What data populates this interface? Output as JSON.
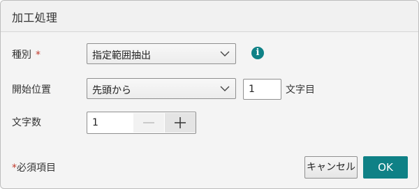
{
  "dialog": {
    "title": "加工処理"
  },
  "fields": {
    "type": {
      "label": "種別",
      "required_mark": "*",
      "value": "指定範囲抽出"
    },
    "start_position": {
      "label": "開始位置",
      "value": "先頭から",
      "offset": "1",
      "suffix": "文字目"
    },
    "char_count": {
      "label": "文字数",
      "value": "1"
    }
  },
  "footer": {
    "required_star": "*",
    "required_note": "必須項目",
    "cancel_label": "キャンセル",
    "ok_label": "OK"
  },
  "colors": {
    "accent": "#0f8186",
    "required": "#c0392b"
  },
  "icons": {
    "info": "info-icon",
    "dropdown": "chevron-down-icon",
    "minus": "minus-icon",
    "plus": "plus-icon"
  }
}
